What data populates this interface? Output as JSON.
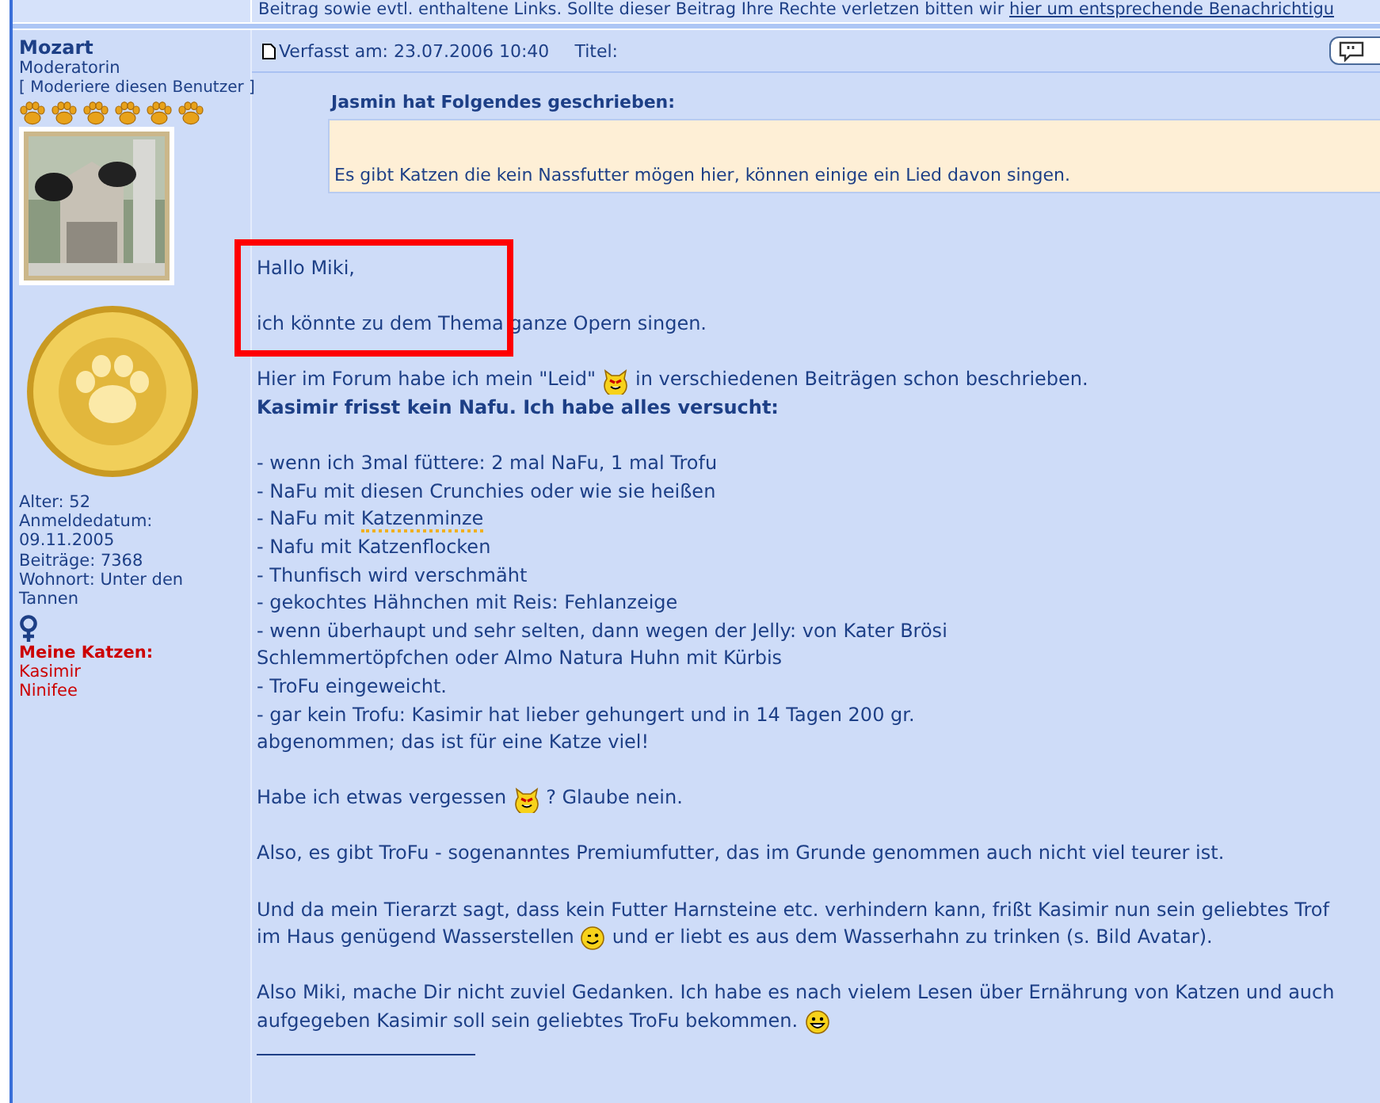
{
  "notice": {
    "text": "Beitrag sowie evtl. enthaltene Links. Sollte dieser Beitrag Ihre Rechte verletzen bitten wir",
    "link": "hier um entsprechende Benachrichtigu"
  },
  "author": {
    "name": "Mozart",
    "rank": "Moderatorin",
    "moderate_link": "[ Moderiere diesen Benutzer ]",
    "stars": 6,
    "details": [
      "Alter: 52",
      "Anmeldedatum:",
      "09.11.2005",
      "Beiträge: 7368",
      "Wohnort: Unter den",
      "Tannen"
    ],
    "cats_label": "Meine Katzen:",
    "cats": [
      "Kasimir",
      "Ninifee"
    ]
  },
  "post": {
    "meta": "Verfasst am: 23.07.2006 10:40",
    "title_label": "Titel:",
    "quote": {
      "author": "Jasmin hat Folgendes geschrieben:",
      "text": "Es gibt Katzen die kein Nassfutter mögen hier, können einige ein Lied davon singen."
    },
    "paragraphs": [
      [
        [
          {
            "kind": "text",
            "text": "Hallo Miki,"
          }
        ]
      ],
      [
        [
          {
            "kind": "text",
            "text": "ich könnte zu dem Thema ganze Opern singen."
          }
        ]
      ],
      [
        [
          {
            "kind": "text",
            "text": "Hier im Forum habe ich mein \"Leid\""
          },
          {
            "kind": "devil"
          },
          {
            "kind": "text",
            "text": "in verschiedenen Beiträgen schon beschrieben."
          }
        ],
        [
          {
            "kind": "bold",
            "text": "Kasimir frisst kein Nafu. Ich habe alles versucht:"
          }
        ]
      ],
      [
        [
          {
            "kind": "text",
            "text": "- wenn ich 3mal füttere: 2 mal NaFu, 1 mal Trofu"
          }
        ],
        [
          {
            "kind": "text",
            "text": "- NaFu mit diesen Crunchies oder wie sie heißen"
          }
        ],
        [
          {
            "kind": "text",
            "text": "- NaFu mit"
          },
          {
            "kind": "link",
            "text": "Katzenminze"
          }
        ],
        [
          {
            "kind": "text",
            "text": "- Nafu mit Katzenflocken"
          }
        ],
        [
          {
            "kind": "text",
            "text": "- Thunfisch wird verschmäht"
          }
        ],
        [
          {
            "kind": "text",
            "text": "- gekochtes Hähnchen mit Reis: Fehlanzeige"
          }
        ],
        [
          {
            "kind": "text",
            "text": "- wenn überhaupt und sehr selten, dann wegen der Jelly: von Kater Brösi"
          }
        ],
        [
          {
            "kind": "text",
            "text": "Schlemmertöpfchen oder Almo Natura Huhn mit Kürbis"
          }
        ],
        [
          {
            "kind": "text",
            "text": "- TroFu eingeweicht."
          }
        ],
        [
          {
            "kind": "text",
            "text": "- gar kein Trofu: Kasimir hat lieber gehungert und in 14 Tagen 200 gr."
          }
        ],
        [
          {
            "kind": "text",
            "text": "abgenommen; das ist für eine Katze viel!"
          }
        ]
      ],
      [
        [
          {
            "kind": "text",
            "text": "Habe ich etwas vergessen"
          },
          {
            "kind": "devil"
          },
          {
            "kind": "text",
            "text": "? Glaube nein."
          }
        ]
      ],
      [
        [
          {
            "kind": "text",
            "text": "Also, es gibt TroFu - sogenanntes Premiumfutter, das im Grunde genommen auch nicht viel teurer ist."
          }
        ]
      ],
      [
        [
          {
            "kind": "text",
            "text": "Und da mein Tierarzt sagt, dass kein Futter Harnsteine etc. verhindern kann, frißt Kasimir nun sein geliebtes Trof"
          }
        ],
        [
          {
            "kind": "text",
            "text": "im Haus genügend Wasserstellen"
          },
          {
            "kind": "wink"
          },
          {
            "kind": "text",
            "text": "und er liebt es aus dem Wasserhahn zu trinken (s. Bild Avatar)."
          }
        ]
      ],
      [
        [
          {
            "kind": "text",
            "text": "Also Miki, mache Dir nicht zuviel Gedanken. Ich habe es nach vielem Lesen über Ernährung von Katzen und auch"
          }
        ],
        [
          {
            "kind": "text",
            "text": "aufgegeben Kasimir soll sein geliebtes TroFu bekommen."
          },
          {
            "kind": "grin"
          }
        ]
      ]
    ]
  }
}
